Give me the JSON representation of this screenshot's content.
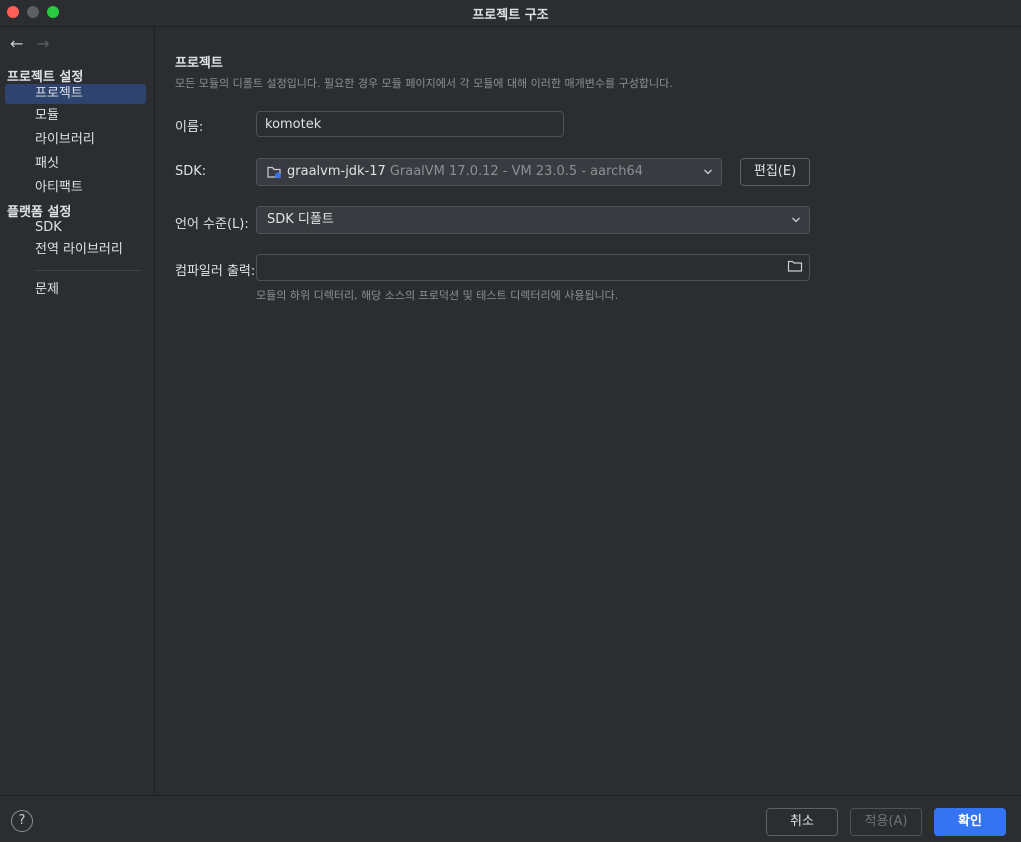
{
  "window": {
    "title": "프로젝트 구조"
  },
  "nav": {
    "back_icon": "←",
    "forward_icon": "→"
  },
  "sidebar": {
    "project_settings_header": "프로젝트 설정",
    "project_items": [
      {
        "label": "프로젝트",
        "selected": true
      },
      {
        "label": "모듈"
      },
      {
        "label": "라이브러리"
      },
      {
        "label": "패싯"
      },
      {
        "label": "아티팩트"
      }
    ],
    "platform_settings_header": "플랫폼 설정",
    "platform_items": [
      {
        "label": "SDK"
      },
      {
        "label": "전역 라이브러리"
      }
    ],
    "problems_label": "문제"
  },
  "main": {
    "title": "프로젝트",
    "description": "모든 모듈의 디폴트 설정입니다. 필요한 경우 모듈 페이지에서 각 모듈에 대해 이러한 매개변수를 구성합니다.",
    "name_label": "이름:",
    "name_value": "komotek",
    "sdk_label": "SDK:",
    "sdk_name": "graalvm-jdk-17",
    "sdk_detail": "GraalVM 17.0.12 - VM 23.0.5 - aarch64",
    "edit_button": "편집(E)",
    "language_level_label": "언어 수준(L):",
    "language_level_value": "SDK 디폴트",
    "compiler_output_label": "컴파일러 출력:",
    "compiler_output_value": "",
    "compiler_output_hint": "모듈의 하위 디렉터리, 해당 소스의 프로덕션 및 테스트 디렉터리에 사용됩니다."
  },
  "footer": {
    "help_icon": "?",
    "cancel_button": "취소",
    "apply_button": "적용(A)",
    "ok_button": "확인"
  },
  "colors": {
    "background": "#2b2d30",
    "selection": "#2e436e",
    "primary_button": "#3574f0"
  }
}
